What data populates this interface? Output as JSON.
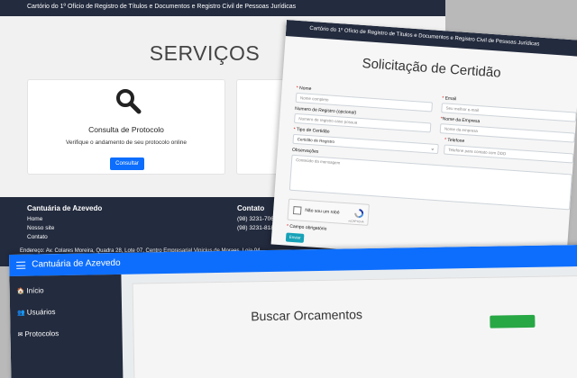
{
  "services_page": {
    "top_bar": "Cartório do 1º Ofício de Registro de Títulos e Documentos e Registro Civil de Pessoas Jurídicas",
    "heading": "SERVIÇOS",
    "card": {
      "icon": "search-icon",
      "title": "Consulta de Protocolo",
      "description": "Verifique o andamento de seu protocolo online",
      "button": "Consultar"
    },
    "footer": {
      "brand": "Cantuária de Azevedo",
      "links": [
        "Home",
        "Nosso site",
        "Contato"
      ],
      "contact_heading": "Contato",
      "phones": [
        "(98) 3231-7062",
        "(98) 3231-8187"
      ],
      "address": "Endereço: Av. Colares Moreira, Quadra 28, Lote 07, Centro Empresarial Vinicius de Moraes, Loja 04,"
    }
  },
  "certidao_form": {
    "top_bar": "Cartório do 1º Ofício de Registro de Títulos e Documentos e Registro Civil de Pessoas Jurídicas",
    "heading": "Solicitação de Certidão",
    "fields": {
      "nome": {
        "label": "Nome",
        "placeholder": "Nome completo"
      },
      "email": {
        "label": "Email",
        "placeholder": "Seu melhor e-mail"
      },
      "registro": {
        "label": "Numero de Registro (opcional)",
        "placeholder": "Numero de registro caso possua"
      },
      "empresa": {
        "label": "Nome da Empresa",
        "placeholder": "Nome da empresa"
      },
      "tipo": {
        "label": "Tipo de Certidão",
        "value": "Certidão de Registro"
      },
      "telefone": {
        "label": "Telefone",
        "placeholder": "Telefone para contato com DDD"
      },
      "obs": {
        "label": "Observações",
        "placeholder": "Conteúdo da mensagem"
      }
    },
    "required_marker": "*",
    "captcha_label": "Não sou um robô",
    "captcha_brand": "reCAPTCHA",
    "required_note": "Campo obrigatório",
    "submit": "Enviar"
  },
  "admin": {
    "brand": "Cantuária de Azevedo",
    "nav": [
      {
        "label": "Início",
        "icon": "home-icon"
      },
      {
        "label": "Usuários",
        "icon": "users-icon"
      },
      {
        "label": "Protocolos",
        "icon": "mail-icon"
      }
    ],
    "panel_title": "Buscar Orcamentos",
    "accent": "#0d6efd"
  }
}
